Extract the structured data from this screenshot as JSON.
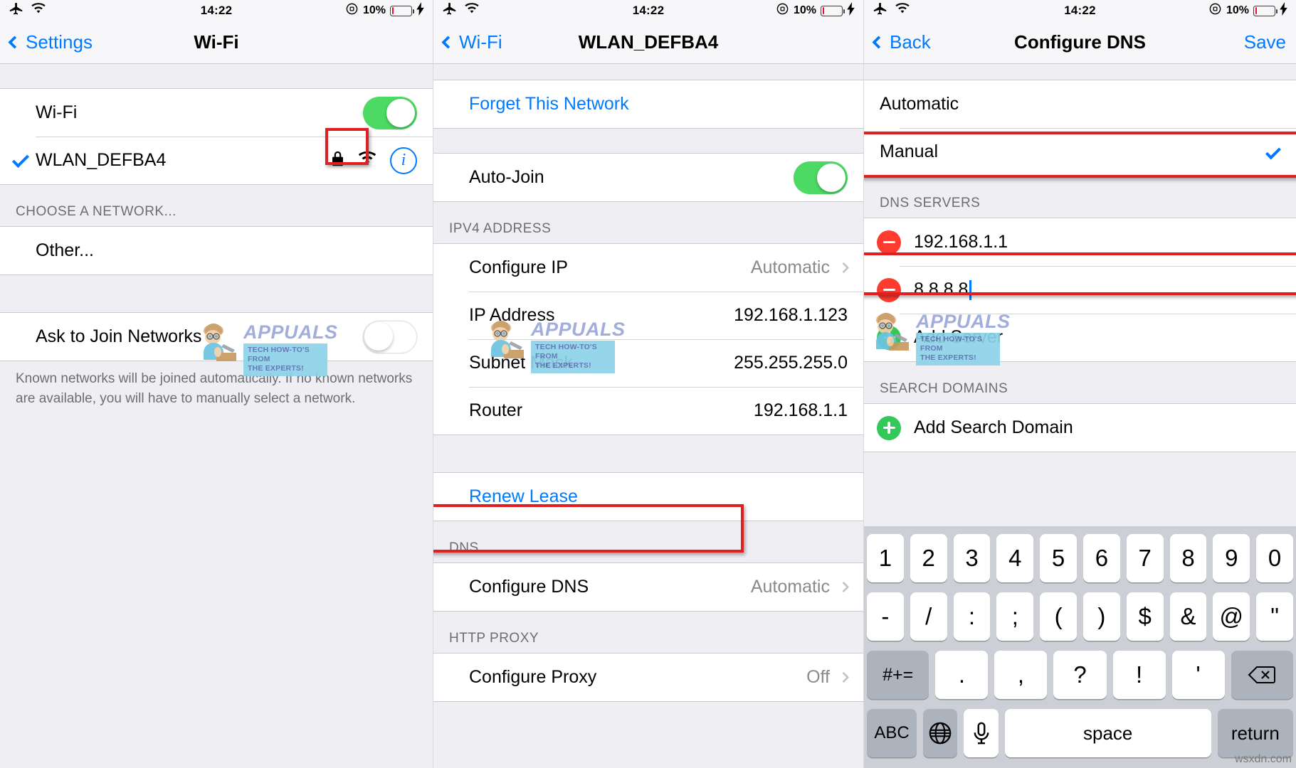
{
  "statusbar": {
    "time": "14:22",
    "battery_percent": "10%"
  },
  "watermark": {
    "brand": "APPUALS",
    "tagline_line1": "TECH HOW-TO'S FROM",
    "tagline_line2": "THE EXPERTS!",
    "corner": "wsxdn.com"
  },
  "screen1": {
    "nav": {
      "back_label": "Settings",
      "title": "Wi-Fi"
    },
    "wifi_row": {
      "label": "Wi-Fi",
      "toggle_state": "on"
    },
    "network_row": {
      "label": "WLAN_DEFBA4",
      "connected": true,
      "lock_icon": "lock-icon",
      "signal_icon": "wifi-icon",
      "info_icon": "info-icon"
    },
    "section_header": "CHOOSE A NETWORK...",
    "other_row": {
      "label": "Other..."
    },
    "ask_row": {
      "label": "Ask to Join Networks",
      "toggle_state": "off"
    },
    "footnote": "Known networks will be joined automatically. If no known networks are available, you will have to manually select a network."
  },
  "screen2": {
    "nav": {
      "back_label": "Wi-Fi",
      "title": "WLAN_DEFBA4"
    },
    "forget_label": "Forget This Network",
    "autojoin": {
      "label": "Auto-Join",
      "toggle_state": "on"
    },
    "ipv4_header": "IPV4 ADDRESS",
    "ipv4_rows": [
      {
        "label": "Configure IP",
        "value": "Automatic",
        "chevron": true
      },
      {
        "label": "IP Address",
        "value": "192.168.1.123",
        "chevron": false
      },
      {
        "label": "Subnet Mask",
        "value": "255.255.255.0",
        "chevron": false
      },
      {
        "label": "Router",
        "value": "192.168.1.1",
        "chevron": false
      }
    ],
    "renew_label": "Renew Lease",
    "dns_header": "DNS",
    "dns_row": {
      "label": "Configure DNS",
      "value": "Automatic",
      "chevron": true
    },
    "proxy_header": "HTTP PROXY",
    "proxy_row": {
      "label": "Configure Proxy",
      "value": "Off",
      "chevron": true
    }
  },
  "screen3": {
    "nav": {
      "back_label": "Back",
      "title": "Configure DNS",
      "save_label": "Save"
    },
    "mode_rows": [
      {
        "label": "Automatic",
        "selected": false
      },
      {
        "label": "Manual",
        "selected": true
      }
    ],
    "servers_header": "DNS SERVERS",
    "servers": [
      {
        "value": "192.168.1.1",
        "editing": false
      },
      {
        "value": "8.8.8.8",
        "editing": true
      }
    ],
    "add_server_label": "Add Server",
    "search_header": "SEARCH DOMAINS",
    "add_search_label": "Add Search Domain",
    "keyboard": {
      "row1": [
        "1",
        "2",
        "3",
        "4",
        "5",
        "6",
        "7",
        "8",
        "9",
        "0"
      ],
      "row2": [
        "-",
        "/",
        ":",
        ";",
        "(",
        ")",
        "$",
        "&",
        "@",
        "\""
      ],
      "row3_left": "#+=",
      "row3": [
        ".",
        ",",
        "?",
        "!",
        "'"
      ],
      "row3_backspace_icon": "backspace-icon",
      "row4": {
        "abc": "ABC",
        "globe_icon": "globe-icon",
        "mic_icon": "microphone-icon",
        "space": "space",
        "return": "return"
      }
    }
  },
  "colors": {
    "accent": "#007aff",
    "toggle_on": "#4cd964",
    "highlight": "#e02020",
    "minus": "#ff3b30",
    "plus": "#34c759"
  }
}
